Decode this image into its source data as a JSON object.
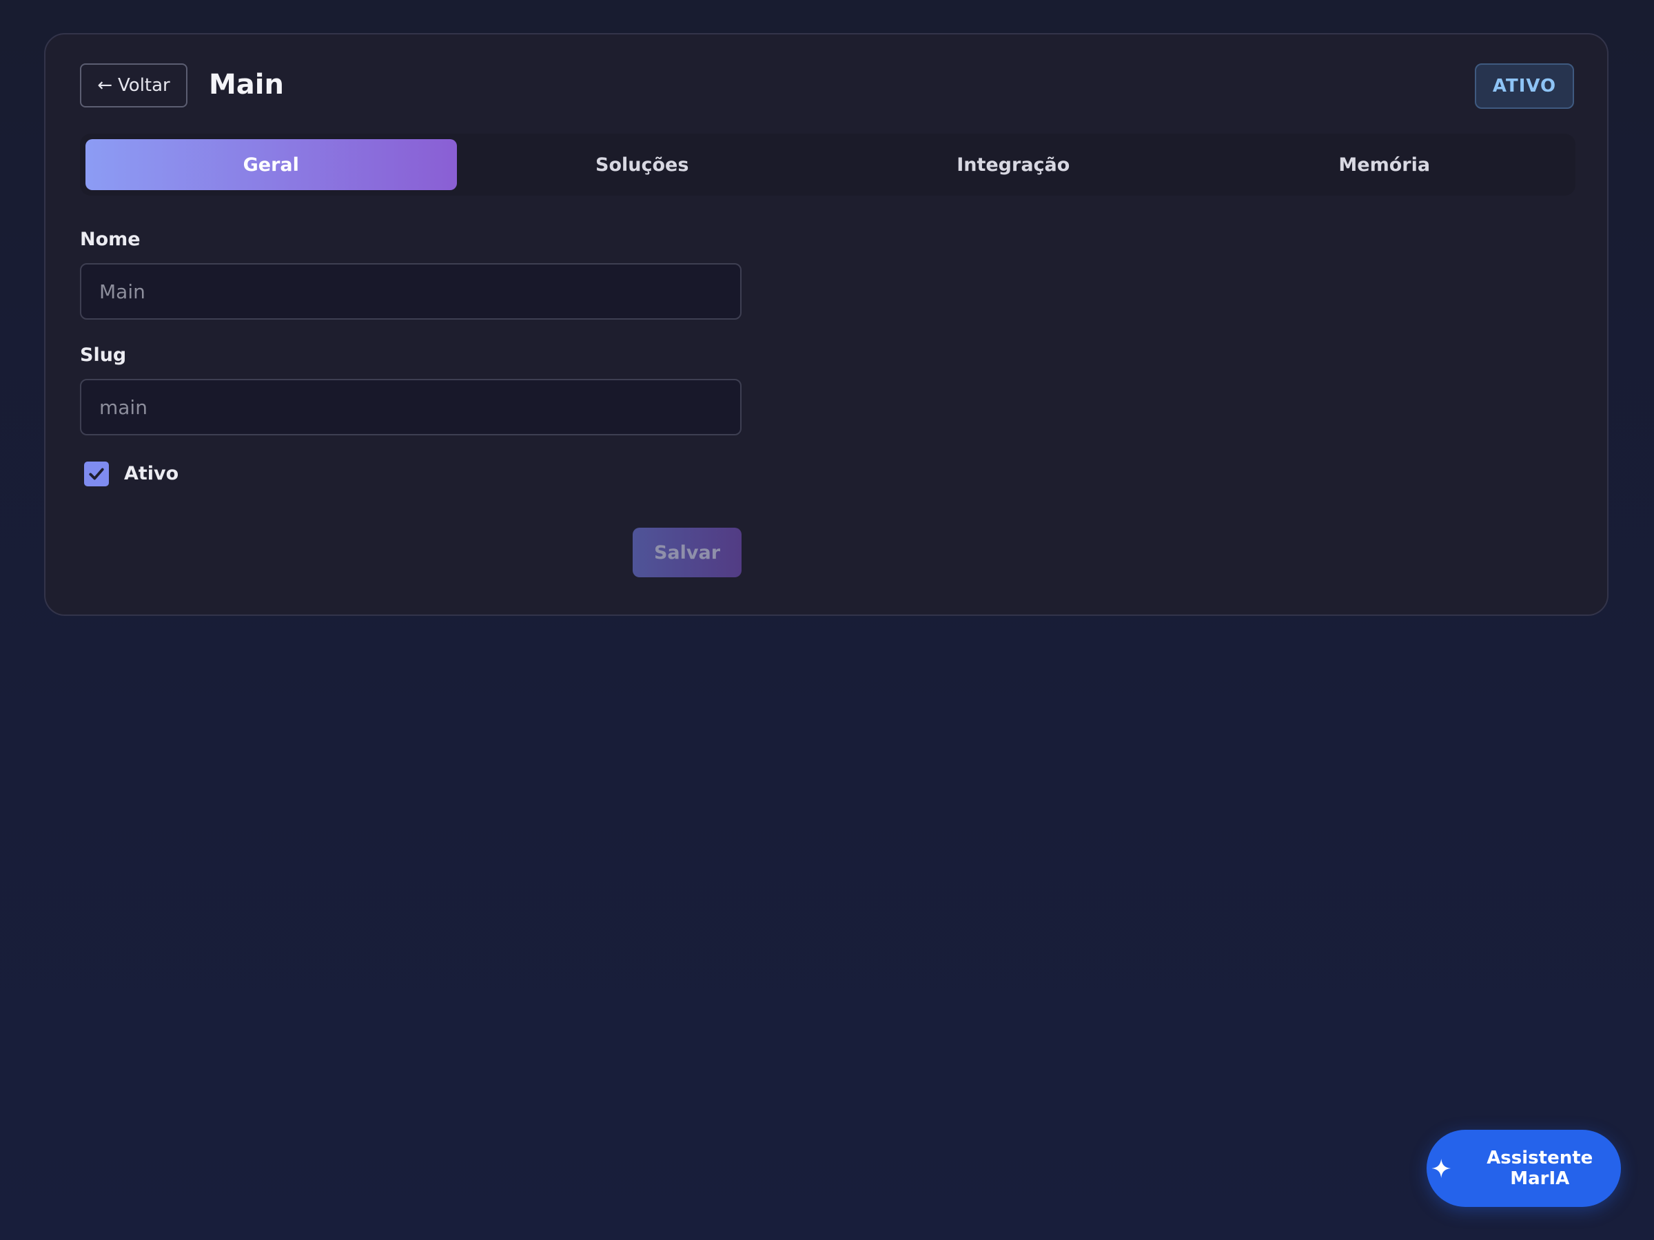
{
  "header": {
    "back_label": "Voltar",
    "back_arrow": "←",
    "title": "Main",
    "status_badge": "ATIVO"
  },
  "tabs": [
    {
      "label": "Geral",
      "active": true
    },
    {
      "label": "Soluções",
      "active": false
    },
    {
      "label": "Integração",
      "active": false
    },
    {
      "label": "Memória",
      "active": false
    }
  ],
  "form": {
    "name_label": "Nome",
    "name_placeholder": "Main",
    "slug_label": "Slug",
    "slug_placeholder": "main",
    "active_label": "Ativo",
    "active_checked": true,
    "save_label": "Salvar"
  },
  "assistant": {
    "label": "Assistente MarIA",
    "icon": "sparkle-icon"
  },
  "colors": {
    "accent_gradient_start": "#8c9cf4",
    "accent_gradient_end": "#8a5fd4",
    "assistant_blue": "#2563eb",
    "badge_text": "#8ec4f6"
  }
}
